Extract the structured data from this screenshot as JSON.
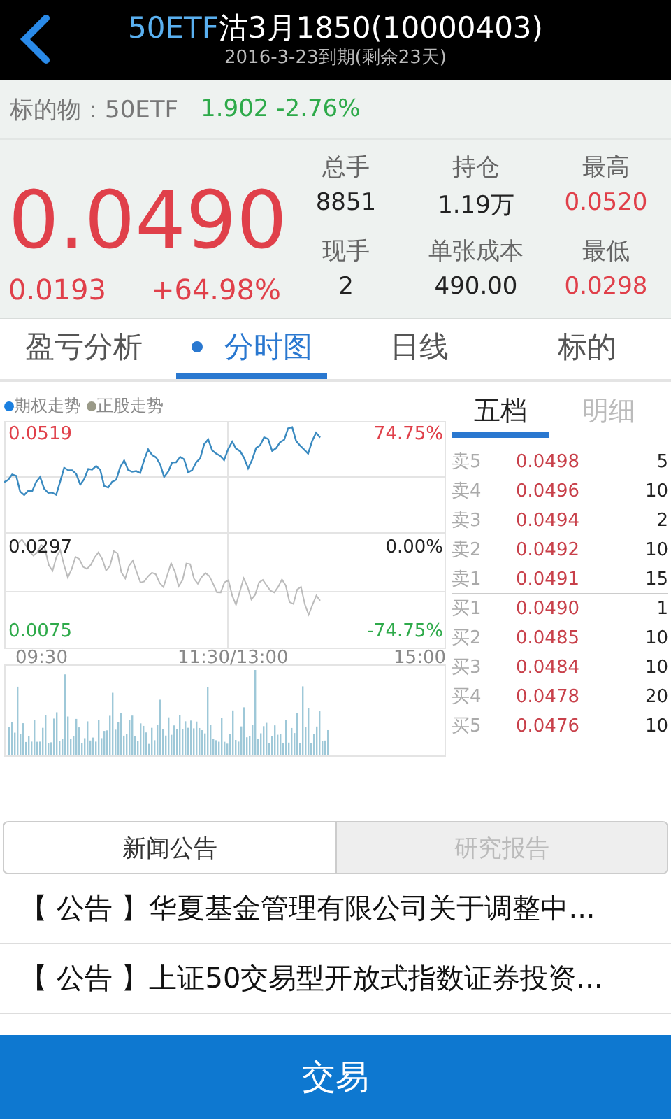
{
  "header": {
    "code": "50ETF",
    "name": "沽3月1850(10000403)",
    "subtitle": "2016-3-23到期(剩余23天)"
  },
  "underlying": {
    "label": "标的物：50ETF",
    "quote": "1.902 -2.76%"
  },
  "price": {
    "last": "0.0490",
    "change": "0.0193",
    "change_pct": "+64.98%"
  },
  "stats": [
    {
      "label": "总手",
      "value": "8851",
      "kind": "plain"
    },
    {
      "label": "持仓",
      "value": "1.19万",
      "kind": "plain"
    },
    {
      "label": "最高",
      "value": "0.0520",
      "kind": "price"
    },
    {
      "label": "现手",
      "value": "2",
      "kind": "plain"
    },
    {
      "label": "单张成本",
      "value": "490.00",
      "kind": "plain"
    },
    {
      "label": "最低",
      "value": "0.0298",
      "kind": "price"
    }
  ],
  "tabs": [
    {
      "label": "盈亏分析",
      "selected": false
    },
    {
      "label": "分时图",
      "selected": true
    },
    {
      "label": "日线",
      "selected": false
    },
    {
      "label": "标的",
      "selected": false
    }
  ],
  "chart": {
    "legend": [
      {
        "label": "期权走势",
        "color": "#1a7fe0"
      },
      {
        "label": "正股走势",
        "color": "#9a9a88"
      }
    ],
    "option_high": "0.0519",
    "option_high_pct": "74.75%",
    "mid": "0.0297",
    "mid_pct": "0.00%",
    "option_low": "0.0075",
    "option_low_pct": "-74.75%",
    "times": [
      "09:30",
      "11:30/13:00",
      "15:00"
    ]
  },
  "book_tabs": [
    {
      "label": "五档",
      "selected": true
    },
    {
      "label": "明细",
      "selected": false
    }
  ],
  "book": [
    {
      "kind": "sell",
      "label": "卖5",
      "price": "0.0498",
      "qty": "5"
    },
    {
      "kind": "sell",
      "label": "卖4",
      "price": "0.0496",
      "qty": "10"
    },
    {
      "kind": "sell",
      "label": "卖3",
      "price": "0.0494",
      "qty": "2"
    },
    {
      "kind": "sell",
      "label": "卖2",
      "price": "0.0492",
      "qty": "10"
    },
    {
      "kind": "sell",
      "label": "卖1",
      "price": "0.0491",
      "qty": "15"
    },
    {
      "kind": "buy",
      "label": "买1",
      "price": "0.0490",
      "qty": "1"
    },
    {
      "kind": "buy",
      "label": "买2",
      "price": "0.0485",
      "qty": "10"
    },
    {
      "kind": "buy",
      "label": "买3",
      "price": "0.0484",
      "qty": "10"
    },
    {
      "kind": "buy",
      "label": "买4",
      "price": "0.0478",
      "qty": "20"
    },
    {
      "kind": "buy",
      "label": "买5",
      "price": "0.0476",
      "qty": "10"
    }
  ],
  "news_tabs": [
    {
      "label": "新闻公告",
      "selected": true
    },
    {
      "label": "研究报告",
      "selected": false
    }
  ],
  "news": [
    {
      "tag": "【 公告 】",
      "title": "华夏基金管理有限公司关于调整中..."
    },
    {
      "tag": "【 公告 】",
      "title": "上证50交易型开放式指数证券投资..."
    }
  ],
  "trade_button": "交易"
}
